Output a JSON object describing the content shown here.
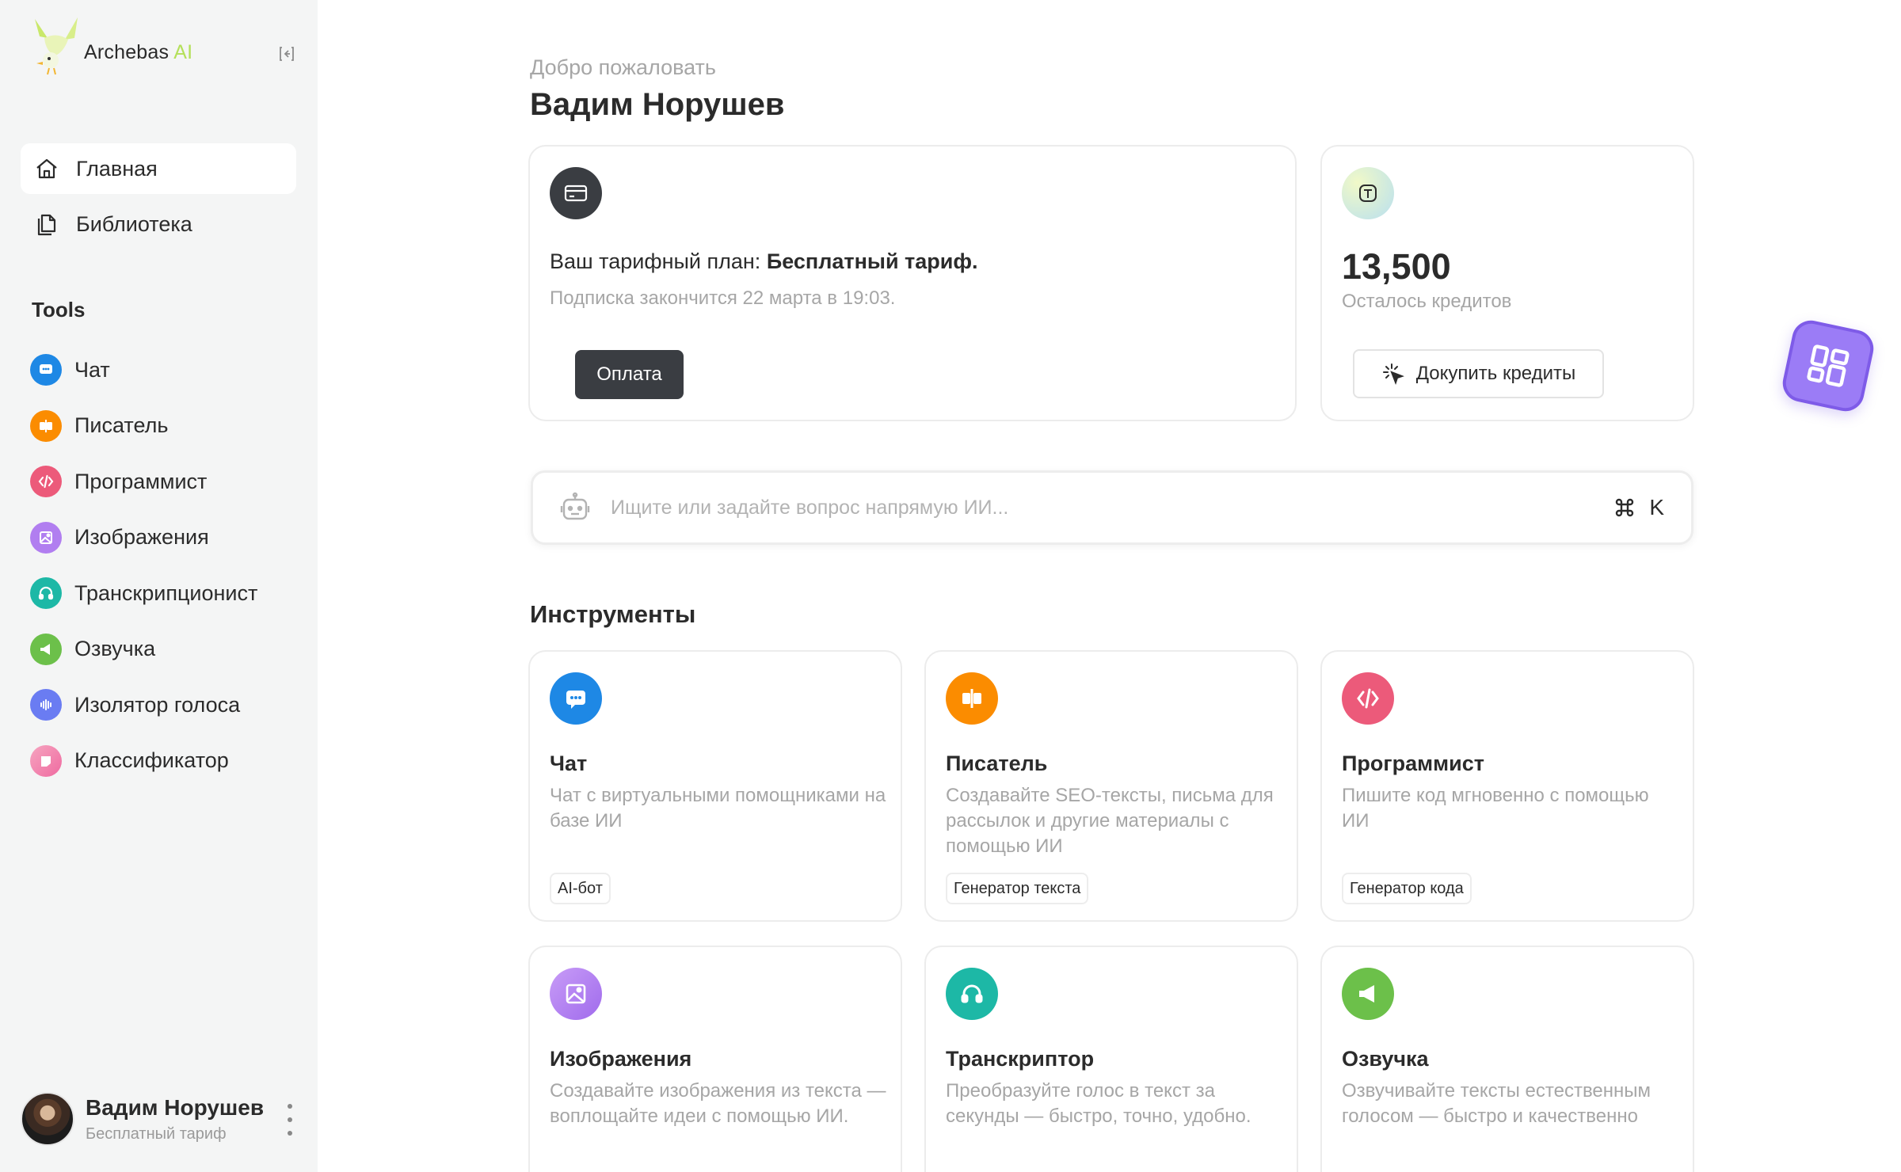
{
  "brand": {
    "name": "Archebas",
    "suffix": "AI"
  },
  "sidebar": {
    "nav": [
      {
        "label": "Главная",
        "icon": "home-icon",
        "active": true
      },
      {
        "label": "Библиотека",
        "icon": "library-icon",
        "active": false
      }
    ],
    "tools_title": "Tools",
    "tools": [
      {
        "label": "Чат",
        "icon": "chat-icon",
        "color": "#1e88e5"
      },
      {
        "label": "Писатель",
        "icon": "writer-icon",
        "color": "#fb8c00"
      },
      {
        "label": "Программист",
        "icon": "code-icon",
        "color": "#ec5a7a"
      },
      {
        "label": "Изображения",
        "icon": "image-icon",
        "color": "#b17ef0"
      },
      {
        "label": "Транскрипционист",
        "icon": "headphones-icon",
        "color": "#1db8a6"
      },
      {
        "label": "Озвучка",
        "icon": "megaphone-icon",
        "color": "#6cc04a"
      },
      {
        "label": "Изолятор голоса",
        "icon": "waveform-icon",
        "color": "#6a7cf2"
      },
      {
        "label": "Классификатор",
        "icon": "classifier-icon",
        "color": "#f47ea5"
      }
    ],
    "user": {
      "name": "Вадим Норушев",
      "plan": "Бесплатный тариф"
    }
  },
  "header": {
    "welcome": "Добро пожаловать",
    "user_name": "Вадим Норушев"
  },
  "plan": {
    "label": "Ваш тарифный план:",
    "value": "Бесплатный тариф.",
    "expires": "Подписка закончится 22 марта в 19:03.",
    "pay_button": "Оплата"
  },
  "credits": {
    "value": "13,500",
    "label": "Осталось кредитов",
    "buy_button": "Докупить кредиты"
  },
  "search": {
    "placeholder": "Ищите или задайте вопрос напрямую ИИ...",
    "shortcut_key": "K"
  },
  "tools_section": {
    "title": "Инструменты",
    "cards": [
      {
        "title": "Чат",
        "description": "Чат с виртуальными помощниками на базе ИИ",
        "tag": "AI-бот",
        "icon": "chat-icon",
        "color": "#1e88e5"
      },
      {
        "title": "Писатель",
        "description": "Создавайте SEO-тексты, письма для рассылок и другие материалы с помощью ИИ",
        "tag": "Генератор текста",
        "icon": "writer-icon",
        "color": "#fb8c00"
      },
      {
        "title": "Программист",
        "description": "Пишите код мгновенно с помощью ИИ",
        "tag": "Генератор кода",
        "icon": "code-icon",
        "color": "#ec5a7a"
      },
      {
        "title": "Изображения",
        "description": "Создавайте изображения из текста — воплощайте идеи с помощью ИИ.",
        "tag": "",
        "icon": "image-icon",
        "color": "#b17ef0"
      },
      {
        "title": "Транскриптор",
        "description": "Преобразуйте голос в текст за секунды — быстро, точно, удобно.",
        "tag": "",
        "icon": "headphones-icon",
        "color": "#1db8a6"
      },
      {
        "title": "Озвучка",
        "description": "Озвучивайте тексты естественным голосом — быстро и качественно",
        "tag": "",
        "icon": "megaphone-icon",
        "color": "#6cc04a"
      }
    ]
  }
}
